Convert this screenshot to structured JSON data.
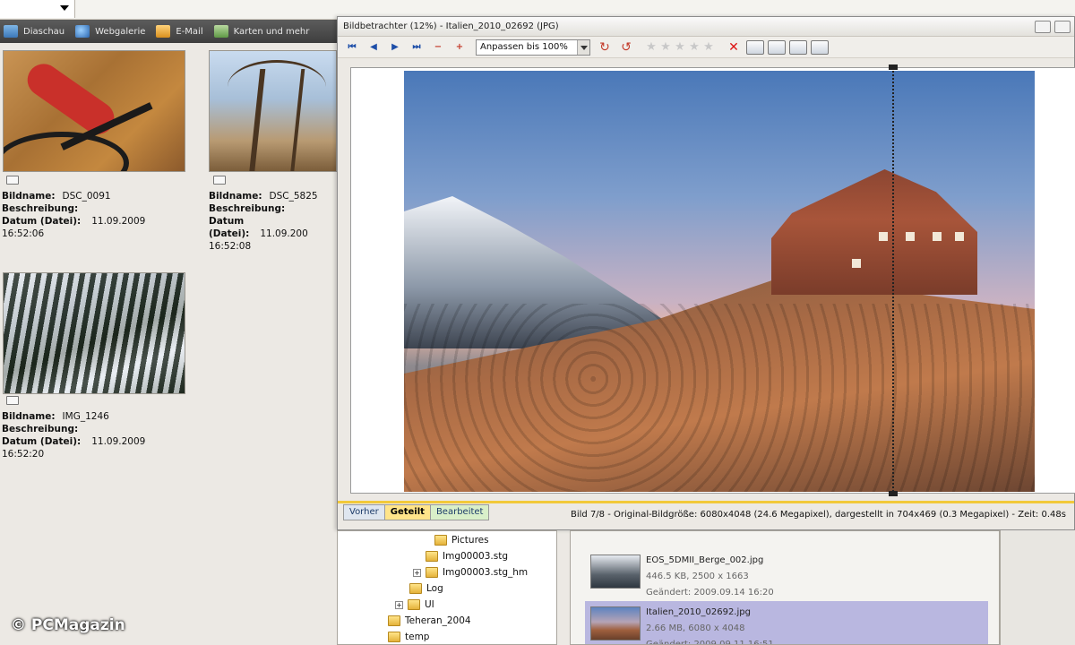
{
  "toolbar": {
    "items": [
      {
        "label": "Diaschau",
        "icon": "slideshow-icon"
      },
      {
        "label": "Webgalerie",
        "icon": "web-gallery-icon"
      },
      {
        "label": "E-Mail",
        "icon": "email-icon"
      },
      {
        "label": "Karten und mehr",
        "icon": "cards-icon"
      }
    ]
  },
  "gallery": {
    "labels": {
      "name": "Bildname:",
      "description": "Beschreibung:",
      "date": "Datum (Datei):"
    },
    "items": [
      {
        "name": "DSC_0091",
        "date": "11.09.2009",
        "time": "16:52:06"
      },
      {
        "name": "DSC_5825",
        "date": "11.09.200",
        "time": "16:52:08"
      },
      {
        "name": "IMG_1246",
        "date": "11.09.2009",
        "time": "16:52:20"
      }
    ]
  },
  "viewer": {
    "title": "Bildbetrachter (12%) - Italien_2010_02692 (JPG)",
    "zoom_value": "Anpassen bis 100%",
    "tabs": [
      "Vorher",
      "Geteilt",
      "Bearbeitet"
    ],
    "status": "Bild 7/8 - Original-Bildgröße: 6080x4048 (24.6 Megapixel), dargestellt in 704x469 (0.3 Megapixel) - Zeit: 0.48s"
  },
  "tree": {
    "items": [
      {
        "label": "Pictures"
      },
      {
        "label": "Img00003.stg"
      },
      {
        "label": "Img00003.stg_hm"
      },
      {
        "label": "Log"
      },
      {
        "label": "UI"
      },
      {
        "label": "Teheran_2004"
      },
      {
        "label": "temp"
      }
    ]
  },
  "files": {
    "items": [
      {
        "name": "EOS_5DMII_Berge_002.jpg",
        "size": "446.5 KB, 2500 x 1663",
        "changed": "Geändert: 2009.09.14 16:20"
      },
      {
        "name": "Italien_2010_02692.jpg",
        "size": "2.66 MB, 6080 x 4048",
        "changed": "Geändert: 2009.09.11 16:51"
      }
    ]
  },
  "watermark": "© PCMagazin",
  "colors": {
    "toolbar_dark": "#4a4a4a",
    "tab_active": "#ffe48a",
    "selection": "#b9b7e0",
    "accent_line": "#f2c93a"
  }
}
